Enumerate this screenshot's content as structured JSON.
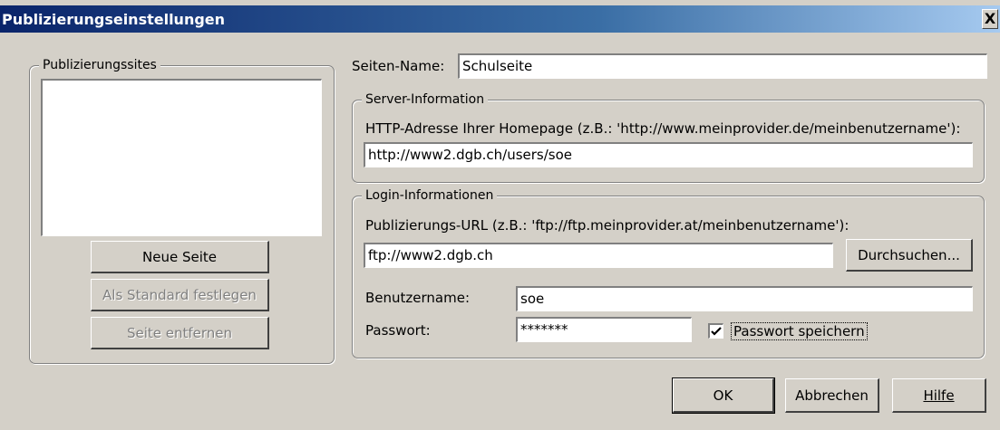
{
  "window": {
    "title": "Publizierungseinstellungen",
    "close_glyph": "X"
  },
  "sites_group": {
    "legend": "Publizierungssites",
    "items": [],
    "new_button": "Neue Seite",
    "default_button": "Als Standard festlegen",
    "remove_button": "Seite entfernen"
  },
  "site_name": {
    "label": "Seiten-Name:",
    "value": "Schulseite"
  },
  "server_info": {
    "legend": "Server-Information",
    "http_label": "HTTP-Adresse Ihrer Homepage (z.B.: 'http://www.meinprovider.de/meinbenutzername'):",
    "http_value": "http://www2.dgb.ch/users/soe"
  },
  "login_info": {
    "legend": "Login-Informationen",
    "url_label": "Publizierungs-URL (z.B.: 'ftp://ftp.meinprovider.at/meinbenutzername'):",
    "url_value": "ftp://www2.dgb.ch",
    "browse_button": "Durchsuchen...",
    "username_label": "Benutzername:",
    "username_value": "soe",
    "password_label": "Passwort:",
    "password_value": "*******",
    "save_password_label": "Passwort speichern",
    "save_password_checked": true
  },
  "footer": {
    "ok_button": "OK",
    "cancel_button": "Abbrechen",
    "help_button": "Hilfe"
  }
}
